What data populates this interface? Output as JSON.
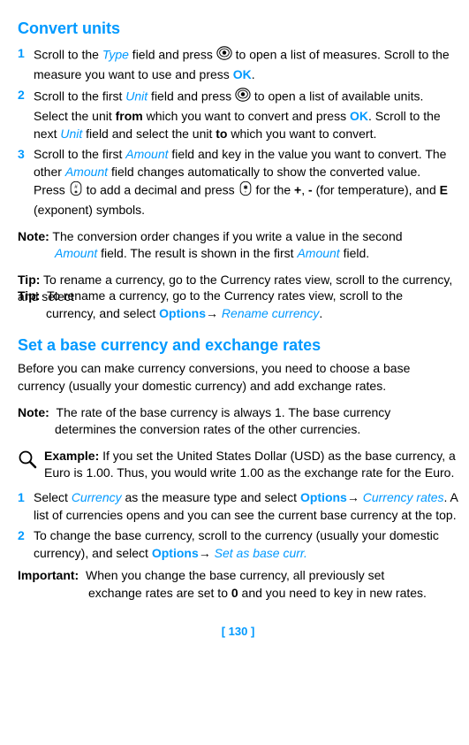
{
  "heading1": "Convert units",
  "step1": {
    "num": "1",
    "p1a": "Scroll to the ",
    "type": "Type",
    "p1b": " field and press ",
    "p1c": " to open a list of measures. Scroll to the measure you want to use and press ",
    "ok": "OK",
    "p1d": "."
  },
  "step2": {
    "num": "2",
    "p1a": "Scroll to the first ",
    "unit": "Unit",
    "p1b": " field and press ",
    "p1c": " to open a list of available units. Select the unit ",
    "from": "from",
    "p1d": " which you want to convert and press ",
    "ok": "OK",
    "p1e": ". Scroll to the next ",
    "p1f": " field and select the unit ",
    "to": "to",
    "p1g": " which you want to convert."
  },
  "step3": {
    "num": "3",
    "p1a": "Scroll to the first ",
    "amount": "Amount",
    "p1b": " field and key in the value you want to convert. The other ",
    "p1c": " field changes automatically to show the converted value.",
    "p2a": "Press ",
    "p2b": " to add a decimal and press ",
    "p2c": " for the ",
    "plus": "+",
    "p2d": ", ",
    "minus": "-",
    "p2e": " (for temperature), and ",
    "exp": "E",
    "p2f": " (exponent) symbols."
  },
  "note1": {
    "label": "Note:",
    "t1a": "  The conversion order changes if you write a value in the second ",
    "amount": "Amount",
    "t1b": " field. The result is shown in the first ",
    "t1c": " field."
  },
  "tip1": {
    "label": "Tip:",
    "t1a": "  To rename a currency, go to the Currency rates view, scroll to the currency, and select ",
    "options": "Options",
    "arrow": "→ ",
    "rename": "Rename currency",
    "t1b": "."
  },
  "heading2": "Set a base currency and exchange rates",
  "intro": "Before you can make currency conversions, you need to choose a base currency (usually your domestic currency) and add exchange rates.",
  "note2": {
    "label": "Note:",
    "t": "  The rate of the base currency is always 1. The base currency determines the conversion rates of the other currencies."
  },
  "example": {
    "label": "Example:",
    "t": " If you set the United States Dollar (USD) as the base currency, a Euro is 1.00.  Thus, you would write 1.00 as the exchange rate for the Euro."
  },
  "step4": {
    "num": "1",
    "p1a": "Select ",
    "currency": "Currency",
    "p1b": " as the measure type and select ",
    "options": "Options",
    "arrow": "→ ",
    "rates": "Currency rates",
    "p1c": ". A list of currencies opens and you can see the current base currency at the top."
  },
  "step5": {
    "num": "2",
    "p1a": "To change the base currency, scroll to the currency (usually your domestic currency), and select ",
    "options": "Options",
    "arrow": "→ ",
    "setbase": "Set as base curr."
  },
  "important": {
    "label": "Important:",
    "t1a": "  When you change the base currency, all previously set exchange rates are set to ",
    "zero": "0",
    "t1b": " and you need to key in new rates."
  },
  "pagenum": "[ 130 ]"
}
